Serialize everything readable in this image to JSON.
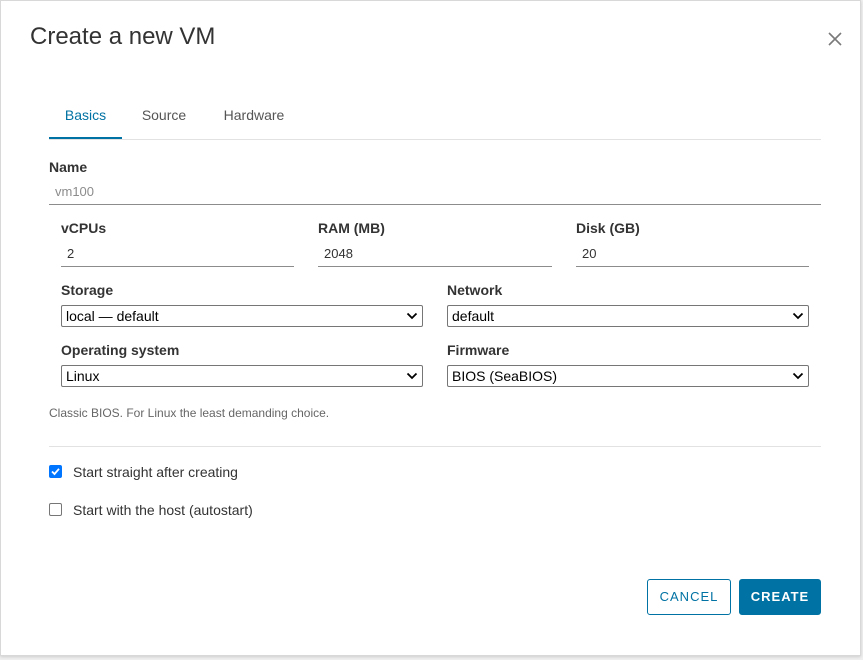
{
  "dialog": {
    "title": "Create a new VM"
  },
  "tabs": [
    {
      "label": "Basics",
      "active": true
    },
    {
      "label": "Source",
      "active": false
    },
    {
      "label": "Hardware",
      "active": false
    }
  ],
  "form": {
    "name": {
      "label": "Name",
      "placeholder": "vm100",
      "value": ""
    },
    "vcpus": {
      "label": "vCPUs",
      "value": "2"
    },
    "ram": {
      "label": "RAM (MB)",
      "value": "2048"
    },
    "disk": {
      "label": "Disk (GB)",
      "value": "20"
    },
    "storage": {
      "label": "Storage",
      "selected": "local — default"
    },
    "network": {
      "label": "Network",
      "selected": "default"
    },
    "os": {
      "label": "Operating system",
      "selected": "Linux"
    },
    "firmware": {
      "label": "Firmware",
      "selected": "BIOS (SeaBIOS)"
    },
    "helper": "Classic BIOS. For Linux the least demanding choice."
  },
  "options": [
    {
      "label": "Start straight after creating",
      "checked": true
    },
    {
      "label": "Start with the host (autostart)",
      "checked": false
    }
  ],
  "buttons": {
    "cancel": "CANCEL",
    "create": "CREATE"
  },
  "colors": {
    "accent": "#0072a3",
    "checkbox": "#0075ff"
  },
  "icons": {
    "close": "close-icon",
    "dropdown": "chevron-down-icon",
    "check": "check-icon"
  }
}
